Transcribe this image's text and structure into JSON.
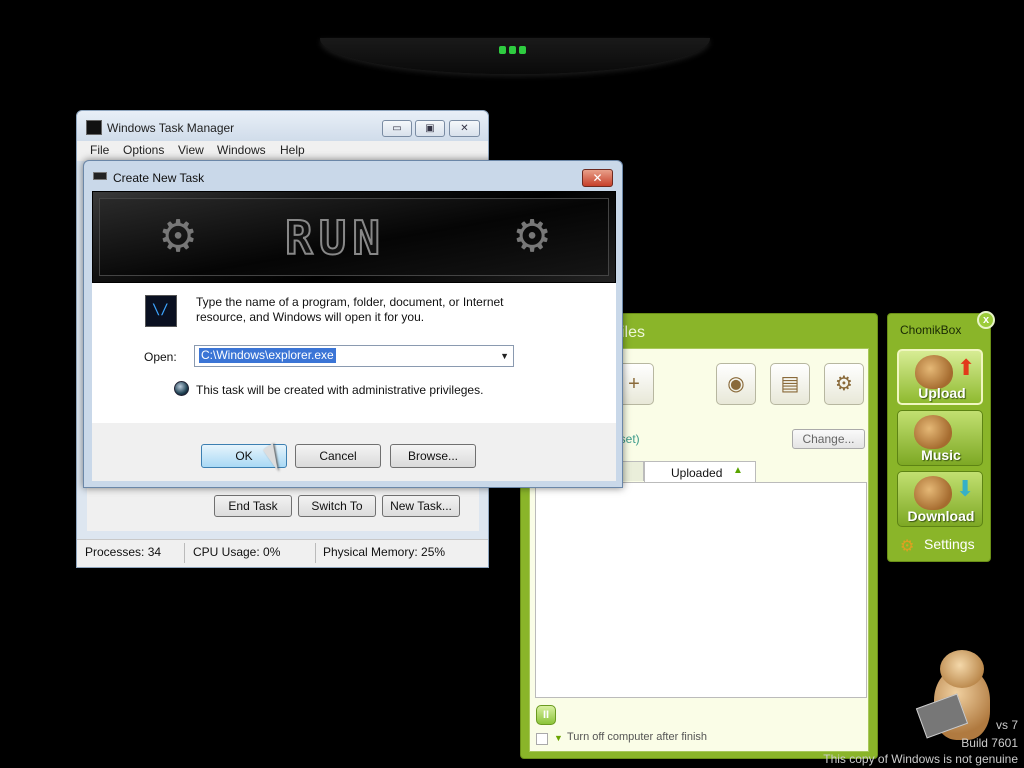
{
  "task_manager": {
    "title": "Windows Task Manager",
    "window_controls": {
      "minimize": "▭",
      "restore": "▣",
      "close": "✕"
    },
    "menu": [
      "File",
      "Options",
      "View",
      "Windows",
      "Help"
    ],
    "buttons": {
      "end_task": "End Task",
      "switch_to": "Switch To",
      "new_task": "New Task..."
    },
    "status": {
      "processes": "Processes: 34",
      "cpu": "CPU Usage: 0%",
      "memory": "Physical Memory: 25%"
    }
  },
  "create_task": {
    "title": "Create New Task",
    "close_label": "✕",
    "banner_text": "RUN",
    "description": "Type the name of a program, folder, document, or Internet resource, and Windows will open it for you.",
    "open_label": "Open:",
    "open_value": "C:\\Windows\\explorer.exe",
    "admin_note": "This task will be created with administrative privileges.",
    "buttons": {
      "ok": "OK",
      "cancel": "Cancel",
      "browse": "Browse..."
    }
  },
  "chomikbox": {
    "window_title_fragment": "iles",
    "link_fragment": "nset)",
    "change_button": "Change...",
    "tab_uploaded": "Uploaded",
    "turn_off": "Turn off computer after finish"
  },
  "side_panel": {
    "title": "ChomikBox",
    "close": "x",
    "buttons": [
      {
        "label": "Upload"
      },
      {
        "label": "Music"
      },
      {
        "label": "Download"
      }
    ],
    "settings": "Settings"
  },
  "desktop": {
    "watermark_line1": "vs 7",
    "watermark_line2": "Build 7601",
    "watermark_line3": "This copy of Windows is not genuine"
  },
  "colors": {
    "chomik_green": "#8ab529",
    "selection_blue": "#3b75d6",
    "close_red": "#c7402a"
  }
}
